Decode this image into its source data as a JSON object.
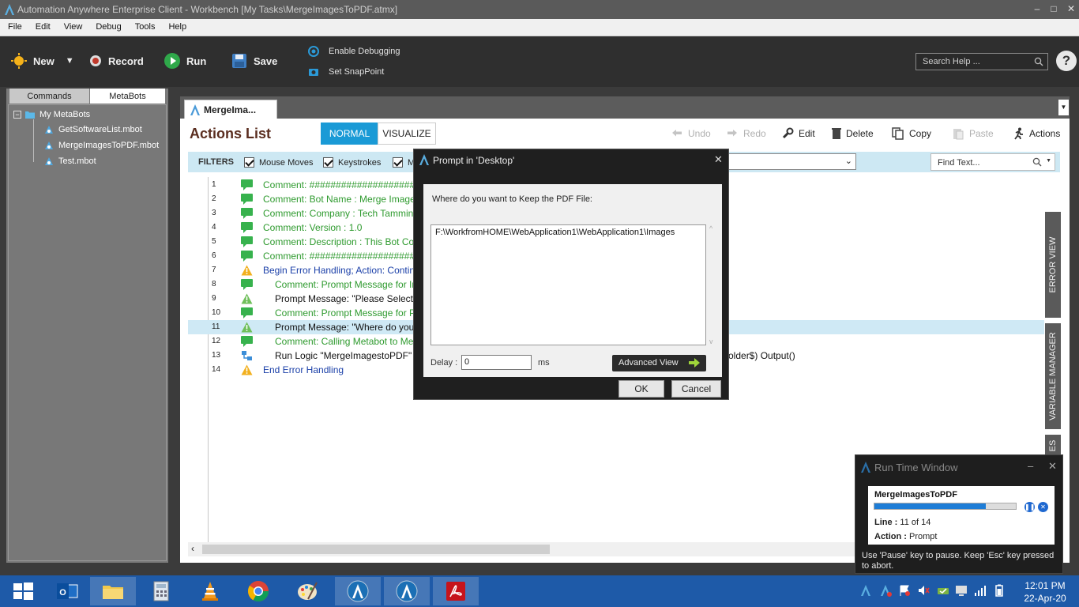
{
  "window": {
    "title": "Automation Anywhere Enterprise Client - Workbench [My Tasks\\MergeImagesToPDF.atmx]",
    "controls": {
      "minimize": "–",
      "maximize": "□",
      "close": "✕"
    }
  },
  "menu": [
    "File",
    "Edit",
    "View",
    "Debug",
    "Tools",
    "Help"
  ],
  "toolbar": {
    "new_label": "New",
    "record_label": "Record",
    "run_label": "Run",
    "save_label": "Save",
    "enable_debugging_label": "Enable Debugging",
    "set_snappoint_label": "Set SnapPoint",
    "search_help_placeholder": "Search Help ...",
    "help_label": "?"
  },
  "left_panel": {
    "tabs": [
      {
        "label": "Commands",
        "active": false
      },
      {
        "label": "MetaBots",
        "active": true
      }
    ],
    "tree": {
      "root": "My MetaBots",
      "collapse": "−",
      "items": [
        "GetSoftwareList.mbot",
        "MergeImagesToPDF.mbot",
        "Test.mbot"
      ]
    }
  },
  "editor": {
    "doc_tab": "MergeIma...",
    "title": "Actions List",
    "modes": {
      "normal": "NORMAL",
      "visualize": "VISUALIZE"
    },
    "actions": {
      "undo": "Undo",
      "redo": "Redo",
      "edit": "Edit",
      "delete": "Delete",
      "copy": "Copy",
      "paste": "Paste",
      "actions": "Actions"
    },
    "filters": {
      "label": "FILTERS",
      "mouse_moves": "Mouse Moves",
      "keystrokes": "Keystrokes",
      "third": "M"
    },
    "find_placeholder": "Find Text...",
    "side_tabs": {
      "error_view": "ERROR VIEW",
      "variable_manager": "VARIABLE MANAGER",
      "third": "ES"
    },
    "lines": [
      {
        "n": "1",
        "type": "comment",
        "text": "Comment: ##########################"
      },
      {
        "n": "2",
        "type": "comment",
        "text": "Comment: Bot Name : Merge Images to"
      },
      {
        "n": "3",
        "type": "comment",
        "text": "Comment: Company : Tech Tammina"
      },
      {
        "n": "4",
        "type": "comment",
        "text": "Comment: Version : 1.0"
      },
      {
        "n": "5",
        "type": "comment",
        "text": "Comment: Description : This Bot Convert"
      },
      {
        "n": "6",
        "type": "comment",
        "text": "Comment: ##########################"
      },
      {
        "n": "7",
        "type": "error",
        "text": "Begin Error Handling; Action: Continue; C"
      },
      {
        "n": "8",
        "type": "comment",
        "text": "Comment: Prompt Message for Image"
      },
      {
        "n": "9",
        "type": "prompt",
        "text": "Prompt Message: \"Please Select you"
      },
      {
        "n": "10",
        "type": "comment",
        "text": "Comment: Prompt Message for PDF F"
      },
      {
        "n": "11",
        "type": "prompt",
        "text": "Prompt Message: \"Where do you wa"
      },
      {
        "n": "12",
        "type": "comment",
        "text": "Comment: Calling Metabot to Merge M"
      },
      {
        "n": "13",
        "type": "logic",
        "text": "Run Logic \"MergeImagestoPDF\" from"
      },
      {
        "n": "14",
        "type": "error",
        "text": "End Error Handling"
      }
    ],
    "line13_tail": "older$) Output()"
  },
  "dialog": {
    "title": "Prompt in 'Desktop'",
    "close": "✕",
    "question": "Where do you want to Keep the PDF File:",
    "value": "F:\\WorkfromHOME\\WebApplication1\\WebApplication1\\Images",
    "delay_label": "Delay :",
    "delay_value": "0",
    "delay_unit": "ms",
    "advanced_label": "Advanced View",
    "ok_label": "OK",
    "cancel_label": "Cancel"
  },
  "runtime": {
    "title": "Run Time Window",
    "task_name": "MergeImagesToPDF",
    "progress": 0.786,
    "line_label": "Line :",
    "line_value": "11 of 14",
    "action_label": "Action :",
    "action_value": "Prompt",
    "hint": "Use 'Pause' key to pause. Keep 'Esc' key pressed to abort.",
    "minimize": "–",
    "close": "✕"
  },
  "taskbar": {
    "time": "12:01 PM",
    "date": "22-Apr-20"
  },
  "colors": {
    "toolbar_bg": "#2f2f2f",
    "accent_blue": "#1a9ad6",
    "comment_green": "#2e9a2e",
    "keyword_blue": "#1a3fa8",
    "taskbar": "#1e5aa8"
  }
}
